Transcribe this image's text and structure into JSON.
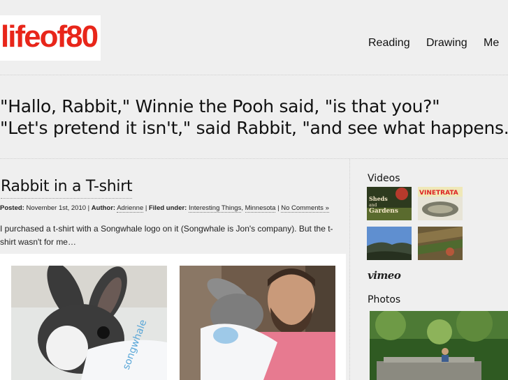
{
  "header": {
    "logo_text": "lifeof80",
    "nav": [
      {
        "label": "Reading"
      },
      {
        "label": "Drawing"
      },
      {
        "label": "Me"
      }
    ]
  },
  "quote": {
    "line1": "\"Hallo, Rabbit,\" Winnie the Pooh said, \"is that you?\"",
    "line2": "\"Let's pretend it isn't,\" said Rabbit, \"and see what happens.\""
  },
  "post": {
    "title": "Rabbit in a T-shirt",
    "meta": {
      "posted_label": "Posted:",
      "posted_value": "November 1st, 2010",
      "sep": "|",
      "author_label": "Author:",
      "author_value": "Adrienne",
      "filed_label": "Filed under:",
      "category1": "Interesting Things",
      "comma": ",",
      "category2": "Minnesota",
      "comments": "No Comments »"
    },
    "excerpt": "I purchased a t-shirt with a Songwhale logo on it (Songwhale is Jon's company). But the t-shirt wasn't for me…",
    "shirt_text": "songwhale"
  },
  "sidebar": {
    "videos_heading": "Videos",
    "video_thumbs": [
      {
        "caption_line1": "Sheds",
        "caption_line2": "and",
        "caption_line3": "Gardens"
      },
      {
        "caption": "VINETRATA"
      },
      {
        "caption": ""
      },
      {
        "caption": ""
      }
    ],
    "vimeo_logo": "vimeo",
    "photos_heading": "Photos"
  },
  "colors": {
    "brand": "#e8261a",
    "background": "#efefef"
  }
}
